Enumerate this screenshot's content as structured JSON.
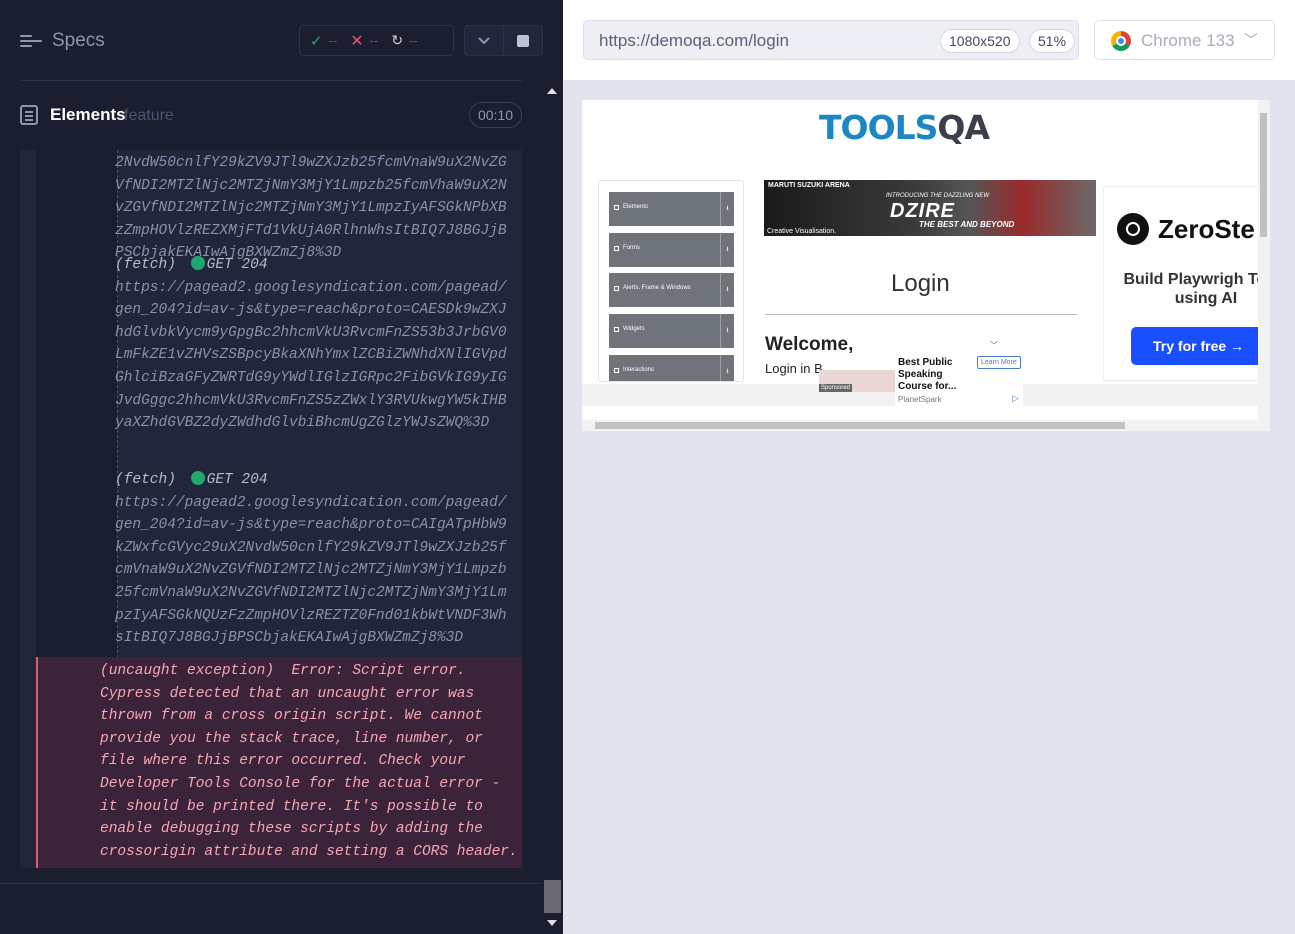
{
  "reporter": {
    "specs_label": "Specs",
    "stats": {
      "passed": "--",
      "failed": "--",
      "pending": "--"
    },
    "spec": {
      "name": "Elements",
      "ext": "feature",
      "duration": "00:10"
    }
  },
  "log": {
    "entry0_tail": "2NvdW50cnlfY29kZV9JTl9wZXJzb25fcmVnaW9uX2NvZGVfNDI2MTZlNjc2MTZjNmY3MjY1Lmpzb25fcmVhaW9uX2NvZGVfNDI2MTZlNjc2MTZjNmY3MjY1LmpzIyAFSGkNPbXBzZmpHOVlzREZXMjFTd1VkUjA0RlhnWhsItBIQ7J8BGJjBPSCbjakEKAIwAjgBXWZmZj8%3D",
    "entries": [
      {
        "type": "(fetch)",
        "method_status": "GET 204",
        "url": "https://pagead2.googlesyndication.com/pagead/gen_204?id=av-js&type=reach&proto=CAESDk9wZXJhdGlvbkVycm9yGpgBc2hhcmVkU3RvcmFnZS53b3JrbGV0LmFkZE1vZHVsZSBpcyBkaXNhYmxlZCBiZWNhdXNlIGVpdGhlciBzaGFyZWRTdG9yYWdlIGlzIGRpc2FibGVkIG9yIGJvdGggc2hhcmVkU3RvcmFnZS5zZWxlY3RVUkwgYW5kIHByaXZhdGVBZ2dyZWdhdGlvbiBhcmUgZGlzYWJsZWQ%3D"
      },
      {
        "type": "(fetch)",
        "method_status": "GET 204",
        "url": "https://pagead2.googlesyndication.com/pagead/gen_204?id=av-js&type=reach&proto=CAIgATpHbW9kZWxfcGVyc29uX2NvdW50cnlfY29kZV9JTl9wZXJzb25fcmVnaW9uX2NvZGVfNDI2MTZlNjc2MTZjNmY3MjY1Lmpzb25fcmVnaW9uX2NvZGVfNDI2MTZlNjc2MTZjNmY3MjY1LmpzIyAFSGkNQUzFzZmpHOVlzREZTZ0Fnd01kbWtVNDF3WhsItBIQ7J8BGJjBPSCbjakEKAIwAjgBXWZmZj8%3D"
      }
    ],
    "error": {
      "prefix": "(uncaught exception)",
      "message": "Error: Script error. Cypress detected that an uncaught error was thrown from a cross origin script. We cannot provide you the stack trace, line number, or file where this error occurred. Check your Developer Tools Console for the actual error - it should be printed there. It's possible to enable debugging these scripts by adding the crossorigin attribute and setting a CORS header."
    }
  },
  "aut_header": {
    "url": "https://demoqa.com/login",
    "viewport": "1080x520",
    "scale": "51%",
    "browser": "Chrome 133"
  },
  "aut": {
    "logo_part1": "TOOLS",
    "logo_part2": "QA",
    "sidebar_groups": [
      "Elements",
      "Forms",
      "Alerts, Frame & Windows",
      "Widgets",
      "Interactions"
    ],
    "banner": {
      "brand": "MARUTI SUZUKI ARENA",
      "intro": "INTRODUCING THE DAZZLING NEW",
      "model": "DZIRE",
      "tagline": "THE BEST AND BEYOND",
      "note": "Creative Visualisation."
    },
    "login_title": "Login",
    "welcome": "Welcome,",
    "login_in": "Login in B",
    "side_ad": {
      "brand": "ZeroSte",
      "headline": "Build Playwrigh Tests using AI",
      "cta": "Try for free →"
    },
    "bottom_ad": {
      "sponsored": "Sponsored",
      "title": "Best Public Speaking Course for...",
      "source": "PlanetSpark",
      "cta": "Learn More"
    }
  }
}
